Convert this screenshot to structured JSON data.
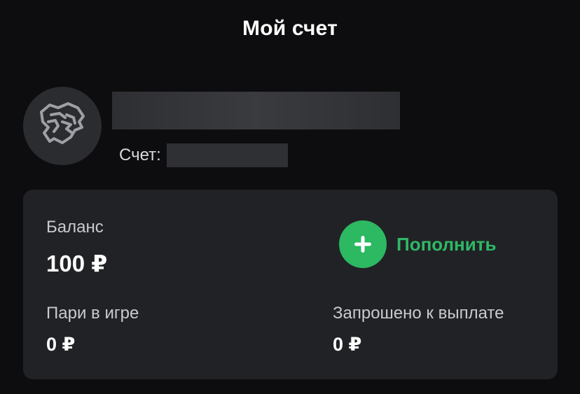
{
  "header": {
    "title": "Мой счет"
  },
  "profile": {
    "avatar_icon": "panther-logo-icon",
    "account_label": "Счет:"
  },
  "balance_card": {
    "balance_label": "Баланс",
    "balance_value": "100 ₽",
    "topup_label": "Пополнить",
    "topup_icon": "plus-icon",
    "bets_label": "Пари в игре",
    "bets_value": "0 ₽",
    "withdraw_label": "Запрошено к выплате",
    "withdraw_value": "0 ₽"
  },
  "colors": {
    "background": "#0d0d0f",
    "card": "#212226",
    "accent_green": "#2db862",
    "avatar_bg": "#2a2c30"
  }
}
